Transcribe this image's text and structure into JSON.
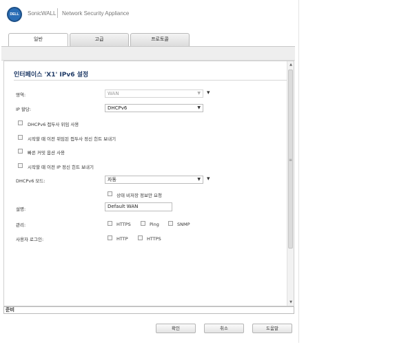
{
  "header": {
    "logo_text": "DELL",
    "brand": "SonicWALL",
    "product": "Network Security Appliance"
  },
  "tabs": [
    {
      "label": "일반",
      "active": true
    },
    {
      "label": "고급",
      "active": false
    },
    {
      "label": "프로토콜",
      "active": false
    }
  ],
  "panel": {
    "title": "인터페이스 'X1' IPv6 설정",
    "zone": {
      "label": "영역:",
      "value": "WAN",
      "disabled": true,
      "required_mark": "▾"
    },
    "ip_assignment": {
      "label": "IP 할당:",
      "value": "DHCPv6"
    },
    "options": [
      {
        "label": "DHCPv6 접두사 위임 사용",
        "checked": false
      },
      {
        "label": "시작할 때 이전 위임된 접두사 정신 힌트 보내기",
        "checked": false
      },
      {
        "label": "빠른 커밋 옵션 사용",
        "checked": false
      },
      {
        "label": "시작할 때 이전 IP 정신 힌트 보내기",
        "checked": false
      }
    ],
    "dhcpv6_mode": {
      "label": "DHCPv6 모드:",
      "value": "자동",
      "required_mark": "▾"
    },
    "stateless_info": {
      "label": "상태 비저장 정보만 요청",
      "checked": false
    },
    "comment": {
      "label": "설명:",
      "value": "Default WAN"
    },
    "management": {
      "label": "관리:",
      "items": [
        {
          "label": "HTTPS",
          "checked": false
        },
        {
          "label": "Ping",
          "checked": false
        },
        {
          "label": "SNMP",
          "checked": false
        }
      ]
    },
    "user_login": {
      "label": "사용자 로그인:",
      "items": [
        {
          "label": "HTTP",
          "checked": false
        },
        {
          "label": "HTTPS",
          "checked": false
        }
      ]
    }
  },
  "status": {
    "text": "준비"
  },
  "buttons": {
    "ok": "확인",
    "cancel": "취소",
    "help": "도움말"
  },
  "icons": {
    "dropdown": "chevron-down-icon",
    "scroll_up": "scroll-up-icon",
    "scroll_down": "scroll-down-icon"
  },
  "colors": {
    "title": "#1f3a66",
    "logo": "#2a6db5"
  }
}
